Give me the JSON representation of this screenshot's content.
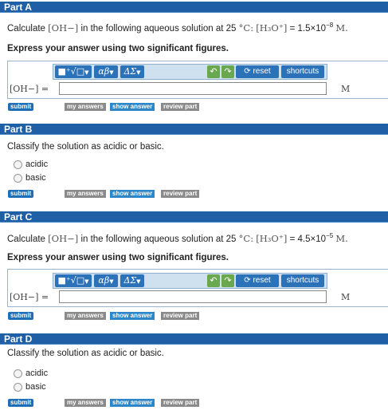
{
  "parts": [
    {
      "title": "Part A",
      "question_prefix": "Calculate",
      "question_oh": "[OH−]",
      "question_mid": "in the following aqueous solution at 25",
      "question_temp": "°C:",
      "question_h3o": "[H₃O⁺]",
      "question_eq": "= 1.5×10",
      "question_exp": "−8",
      "question_unit": "M.",
      "instruction": "Express your answer using two significant figures.",
      "input_label": "[OH−] =",
      "input_value": "",
      "unit": "M"
    },
    {
      "title": "Part B",
      "question": "Classify the solution as acidic or basic.",
      "options": [
        "acidic",
        "basic"
      ]
    },
    {
      "title": "Part C",
      "question_prefix": "Calculate",
      "question_oh": "[OH−]",
      "question_mid": "in the following aqueous solution at 25",
      "question_temp": "°C:",
      "question_h3o": "[H₃O⁺]",
      "question_eq": "= 4.5×10",
      "question_exp": "−5",
      "question_unit": "M.",
      "instruction": "Express your answer using two significant figures.",
      "input_label": "[OH−] =",
      "input_value": "",
      "unit": "M"
    },
    {
      "title": "Part D",
      "question": "Classify the solution as acidic or basic.",
      "options": [
        "acidic",
        "basic"
      ]
    }
  ],
  "toolbar": {
    "templates_label": "■⁺√□",
    "greek_label": "αβ",
    "symbols_label": "ΔΣ",
    "undo_icon": "undo-icon",
    "redo_icon": "redo-icon",
    "reset_label": "reset",
    "shortcuts_label": "shortcuts"
  },
  "actions": {
    "submit": "submit",
    "my_answers": "my answers",
    "show_answer": "show answer",
    "review_part": "review part"
  },
  "colors": {
    "header_bg": "#1e5fa6",
    "toolbar_bg": "#cfe0ef",
    "button_blue": "#2c72b8",
    "button_gray": "#8a8a8a"
  }
}
